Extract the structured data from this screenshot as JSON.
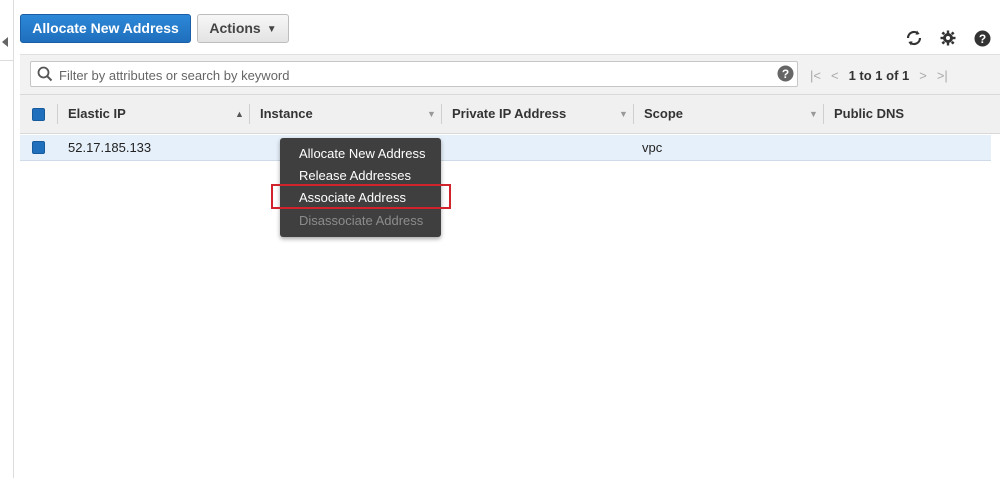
{
  "toolbar": {
    "allocate_label": "Allocate New Address",
    "actions_label": "Actions"
  },
  "icons": {
    "refresh": "refresh-icon",
    "settings": "gear-icon",
    "help": "help-icon"
  },
  "search": {
    "placeholder": "Filter by attributes or search by keyword"
  },
  "pagination": {
    "range_text": "1 to 1 of 1"
  },
  "table": {
    "columns": [
      "Elastic IP",
      "Instance",
      "Private IP Address",
      "Scope",
      "Public DNS"
    ],
    "rows": [
      {
        "elastic_ip": "52.17.185.133",
        "instance": "",
        "private_ip": "",
        "scope": "vpc",
        "public_dns": ""
      }
    ]
  },
  "context_menu": {
    "items": [
      {
        "label": "Allocate New Address",
        "enabled": true
      },
      {
        "label": "Release Addresses",
        "enabled": true
      },
      {
        "label": "Associate Address",
        "enabled": true
      },
      {
        "label": "Disassociate Address",
        "enabled": false
      }
    ]
  },
  "colors": {
    "primary": "#1f6fbd",
    "highlight_border": "#d0232c",
    "menu_bg": "#3f3f3f",
    "selected_row": "#e6f0fa"
  }
}
